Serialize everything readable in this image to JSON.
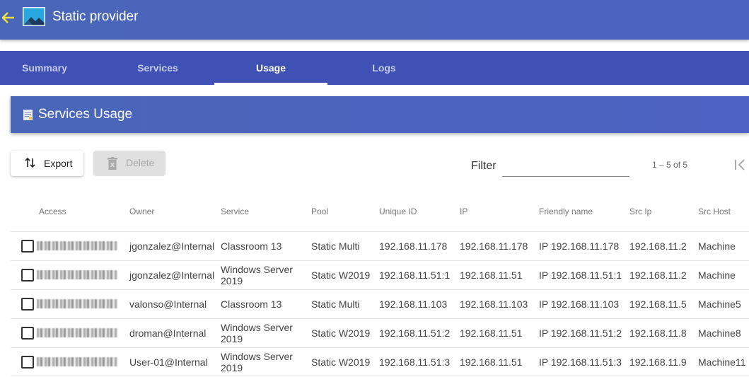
{
  "header": {
    "title": "Static provider",
    "back_icon": "arrow-left-icon",
    "app_icon": "image-icon"
  },
  "tabs": [
    {
      "label": "Summary",
      "active": false
    },
    {
      "label": "Services",
      "active": false
    },
    {
      "label": "Usage",
      "active": true
    },
    {
      "label": "Logs",
      "active": false
    }
  ],
  "card": {
    "title": "Services Usage",
    "icon": "document-icon"
  },
  "toolbar": {
    "export_label": "Export",
    "delete_label": "Delete",
    "filter_label": "Filter",
    "filter_value": "",
    "range_label": "1 – 5 of 5"
  },
  "table": {
    "columns": [
      "Access",
      "Owner",
      "Service",
      "Pool",
      "Unique ID",
      "IP",
      "Friendly name",
      "Src Ip",
      "Src Host"
    ],
    "rows": [
      {
        "owner": "jgonzalez@Internal",
        "service": "Classroom 13",
        "pool": "Static Multi",
        "unique_id": "192.168.11.178",
        "ip": "192.168.11.178",
        "friendly": "IP 192.168.11.178",
        "src_ip": "192.168.11.2",
        "src_host": "Machine"
      },
      {
        "owner": "jgonzalez@Internal",
        "service": "Windows Server 2019",
        "pool": "Static W2019",
        "unique_id": "192.168.11.51:1",
        "ip": "192.168.11.51",
        "friendly": "IP 192.168.11.51:1",
        "src_ip": "192.168.11.2",
        "src_host": "Machine"
      },
      {
        "owner": "valonso@Internal",
        "service": "Classroom 13",
        "pool": "Static Multi",
        "unique_id": "192.168.11.103",
        "ip": "192.168.11.103",
        "friendly": "IP 192.168.11.103",
        "src_ip": "192.168.11.5",
        "src_host": "Machine5"
      },
      {
        "owner": "droman@Internal",
        "service": "Windows Server 2019",
        "pool": "Static W2019",
        "unique_id": "192.168.11.51:2",
        "ip": "192.168.11.51",
        "friendly": "IP 192.168.11.51:2",
        "src_ip": "192.168.11.8",
        "src_host": "Machine8"
      },
      {
        "owner": "User-01@Internal",
        "service": "Windows Server 2019",
        "pool": "Static W2019",
        "unique_id": "192.168.11.51:3",
        "ip": "192.168.11.51",
        "friendly": "IP 192.168.11.51:3",
        "src_ip": "192.168.11.9",
        "src_host": "Machine11"
      }
    ]
  },
  "colors": {
    "primary": "#3f51b5",
    "accent_back_arrow": "#f4e23a"
  }
}
